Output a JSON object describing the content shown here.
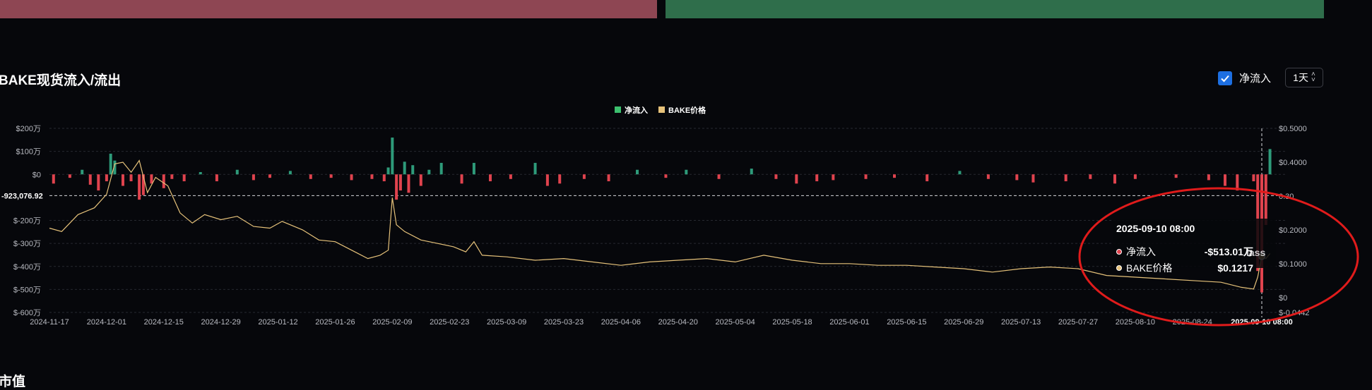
{
  "header": {
    "title": "BAKE现货流入/流出",
    "toggle_label": "净流入",
    "period": "1天"
  },
  "footer": {
    "title": "市值"
  },
  "tooltip": {
    "time": "2025-09-10 08:00",
    "rows": [
      {
        "label": "净流入",
        "value": "-$513.01万",
        "color": "#e0434e"
      },
      {
        "label": "BAKE价格",
        "value": "$0.1217",
        "color": "#e6c27a"
      }
    ],
    "overlay_text": "lass"
  },
  "colors": {
    "inflow": "#2e9b7a",
    "outflow": "#e0434e",
    "price": "#e6c27a",
    "annotation": "#e01b1b",
    "accent": "#1d6fe2"
  },
  "chart_data": {
    "type": "bar",
    "legend": [
      "净流入",
      "BAKE价格"
    ],
    "legend_position": "top-center",
    "x_ticks": [
      "2024-11-17",
      "2024-12-01",
      "2024-12-15",
      "2024-12-29",
      "2025-01-12",
      "2025-01-26",
      "2025-02-09",
      "2025-02-23",
      "2025-03-09",
      "2025-03-23",
      "2025-04-06",
      "2025-04-20",
      "2025-05-04",
      "2025-05-18",
      "2025-06-01",
      "2025-06-15",
      "2025-06-29",
      "2025-07-13",
      "2025-07-27",
      "2025-08-10",
      "2025-08-24",
      "2025-09-10 08:00"
    ],
    "y_left_ticks": [
      "$200万",
      "$100万",
      "$0",
      "$-200万",
      "$-300万",
      "$-400万",
      "$-500万",
      "$-600万"
    ],
    "y_right_ticks": [
      "$0.5000",
      "$0.4000",
      "0.30",
      "$0.2000",
      "$0.1000",
      "$0",
      "$-0.0442"
    ],
    "crosshair_label": "-923,076.92",
    "ylim_left": [
      -600,
      200
    ],
    "ylim_right": [
      -0.0442,
      0.5
    ],
    "series": [
      {
        "name": "净流入",
        "type": "bar",
        "unit": "万",
        "points": [
          [
            "2024-11-18",
            -40
          ],
          [
            "2024-11-22",
            -15
          ],
          [
            "2024-11-25",
            20
          ],
          [
            "2024-11-27",
            -45
          ],
          [
            "2024-11-29",
            -70
          ],
          [
            "2024-12-01",
            -30
          ],
          [
            "2024-12-02",
            90
          ],
          [
            "2024-12-03",
            60
          ],
          [
            "2024-12-05",
            -50
          ],
          [
            "2024-12-07",
            -30
          ],
          [
            "2024-12-09",
            -110
          ],
          [
            "2024-12-10",
            -90
          ],
          [
            "2024-12-12",
            -40
          ],
          [
            "2024-12-15",
            -60
          ],
          [
            "2024-12-17",
            -20
          ],
          [
            "2024-12-20",
            -30
          ],
          [
            "2024-12-24",
            10
          ],
          [
            "2024-12-28",
            -30
          ],
          [
            "2025-01-02",
            20
          ],
          [
            "2025-01-06",
            -25
          ],
          [
            "2025-01-10",
            -15
          ],
          [
            "2025-01-15",
            15
          ],
          [
            "2025-01-20",
            -20
          ],
          [
            "2025-01-25",
            -15
          ],
          [
            "2025-01-30",
            -25
          ],
          [
            "2025-02-04",
            -20
          ],
          [
            "2025-02-07",
            -30
          ],
          [
            "2025-02-08",
            30
          ],
          [
            "2025-02-09",
            160
          ],
          [
            "2025-02-10",
            -110
          ],
          [
            "2025-02-11",
            -70
          ],
          [
            "2025-02-12",
            55
          ],
          [
            "2025-02-13",
            -80
          ],
          [
            "2025-02-14",
            40
          ],
          [
            "2025-02-16",
            -50
          ],
          [
            "2025-02-18",
            20
          ],
          [
            "2025-02-21",
            50
          ],
          [
            "2025-02-26",
            -40
          ],
          [
            "2025-03-01",
            50
          ],
          [
            "2025-03-05",
            -30
          ],
          [
            "2025-03-10",
            -20
          ],
          [
            "2025-03-16",
            50
          ],
          [
            "2025-03-19",
            -50
          ],
          [
            "2025-03-22",
            -40
          ],
          [
            "2025-03-28",
            -20
          ],
          [
            "2025-04-03",
            -30
          ],
          [
            "2025-04-10",
            20
          ],
          [
            "2025-04-17",
            -15
          ],
          [
            "2025-04-22",
            20
          ],
          [
            "2025-04-30",
            -20
          ],
          [
            "2025-05-08",
            25
          ],
          [
            "2025-05-14",
            -20
          ],
          [
            "2025-05-19",
            -40
          ],
          [
            "2025-05-24",
            -30
          ],
          [
            "2025-05-28",
            -25
          ],
          [
            "2025-06-05",
            -20
          ],
          [
            "2025-06-12",
            -15
          ],
          [
            "2025-06-20",
            -30
          ],
          [
            "2025-06-28",
            15
          ],
          [
            "2025-07-05",
            -20
          ],
          [
            "2025-07-12",
            -25
          ],
          [
            "2025-07-16",
            -35
          ],
          [
            "2025-07-24",
            -30
          ],
          [
            "2025-07-30",
            -20
          ],
          [
            "2025-08-05",
            -40
          ],
          [
            "2025-08-10",
            -20
          ],
          [
            "2025-08-20",
            -15
          ],
          [
            "2025-08-28",
            -25
          ],
          [
            "2025-09-01",
            -50
          ],
          [
            "2025-09-04",
            -70
          ],
          [
            "2025-09-08",
            -30
          ],
          [
            "2025-09-09",
            -420
          ],
          [
            "2025-09-10",
            -513.01
          ],
          [
            "2025-09-11",
            -220
          ],
          [
            "2025-09-12",
            110
          ]
        ]
      },
      {
        "name": "BAKE价格",
        "type": "line",
        "unit": "$",
        "points": [
          [
            "2024-11-17",
            0.205
          ],
          [
            "2024-11-20",
            0.195
          ],
          [
            "2024-11-24",
            0.245
          ],
          [
            "2024-11-28",
            0.265
          ],
          [
            "2024-12-01",
            0.305
          ],
          [
            "2024-12-03",
            0.395
          ],
          [
            "2024-12-05",
            0.4
          ],
          [
            "2024-12-07",
            0.37
          ],
          [
            "2024-12-09",
            0.405
          ],
          [
            "2024-12-11",
            0.31
          ],
          [
            "2024-12-13",
            0.355
          ],
          [
            "2024-12-16",
            0.33
          ],
          [
            "2024-12-19",
            0.25
          ],
          [
            "2024-12-22",
            0.22
          ],
          [
            "2024-12-25",
            0.245
          ],
          [
            "2024-12-29",
            0.23
          ],
          [
            "2025-01-02",
            0.24
          ],
          [
            "2025-01-06",
            0.21
          ],
          [
            "2025-01-10",
            0.205
          ],
          [
            "2025-01-13",
            0.225
          ],
          [
            "2025-01-18",
            0.2
          ],
          [
            "2025-01-22",
            0.17
          ],
          [
            "2025-01-26",
            0.165
          ],
          [
            "2025-01-30",
            0.14
          ],
          [
            "2025-02-03",
            0.115
          ],
          [
            "2025-02-06",
            0.125
          ],
          [
            "2025-02-08",
            0.14
          ],
          [
            "2025-02-09",
            0.295
          ],
          [
            "2025-02-10",
            0.215
          ],
          [
            "2025-02-12",
            0.195
          ],
          [
            "2025-02-16",
            0.17
          ],
          [
            "2025-02-20",
            0.16
          ],
          [
            "2025-02-24",
            0.15
          ],
          [
            "2025-02-27",
            0.135
          ],
          [
            "2025-03-01",
            0.165
          ],
          [
            "2025-03-03",
            0.125
          ],
          [
            "2025-03-09",
            0.12
          ],
          [
            "2025-03-16",
            0.11
          ],
          [
            "2025-03-23",
            0.115
          ],
          [
            "2025-03-30",
            0.105
          ],
          [
            "2025-04-06",
            0.095
          ],
          [
            "2025-04-13",
            0.105
          ],
          [
            "2025-04-20",
            0.11
          ],
          [
            "2025-04-27",
            0.115
          ],
          [
            "2025-05-04",
            0.105
          ],
          [
            "2025-05-11",
            0.125
          ],
          [
            "2025-05-18",
            0.11
          ],
          [
            "2025-05-25",
            0.1
          ],
          [
            "2025-06-01",
            0.1
          ],
          [
            "2025-06-08",
            0.095
          ],
          [
            "2025-06-15",
            0.095
          ],
          [
            "2025-06-22",
            0.09
          ],
          [
            "2025-06-29",
            0.085
          ],
          [
            "2025-07-06",
            0.075
          ],
          [
            "2025-07-13",
            0.085
          ],
          [
            "2025-07-20",
            0.09
          ],
          [
            "2025-07-27",
            0.085
          ],
          [
            "2025-08-03",
            0.065
          ],
          [
            "2025-08-10",
            0.06
          ],
          [
            "2025-08-17",
            0.055
          ],
          [
            "2025-08-24",
            0.05
          ],
          [
            "2025-08-31",
            0.045
          ],
          [
            "2025-09-05",
            0.03
          ],
          [
            "2025-09-08",
            0.025
          ],
          [
            "2025-09-09",
            0.06
          ],
          [
            "2025-09-10",
            0.1217
          ],
          [
            "2025-09-11",
            0.115
          ],
          [
            "2025-09-12",
            0.13
          ]
        ]
      }
    ]
  }
}
